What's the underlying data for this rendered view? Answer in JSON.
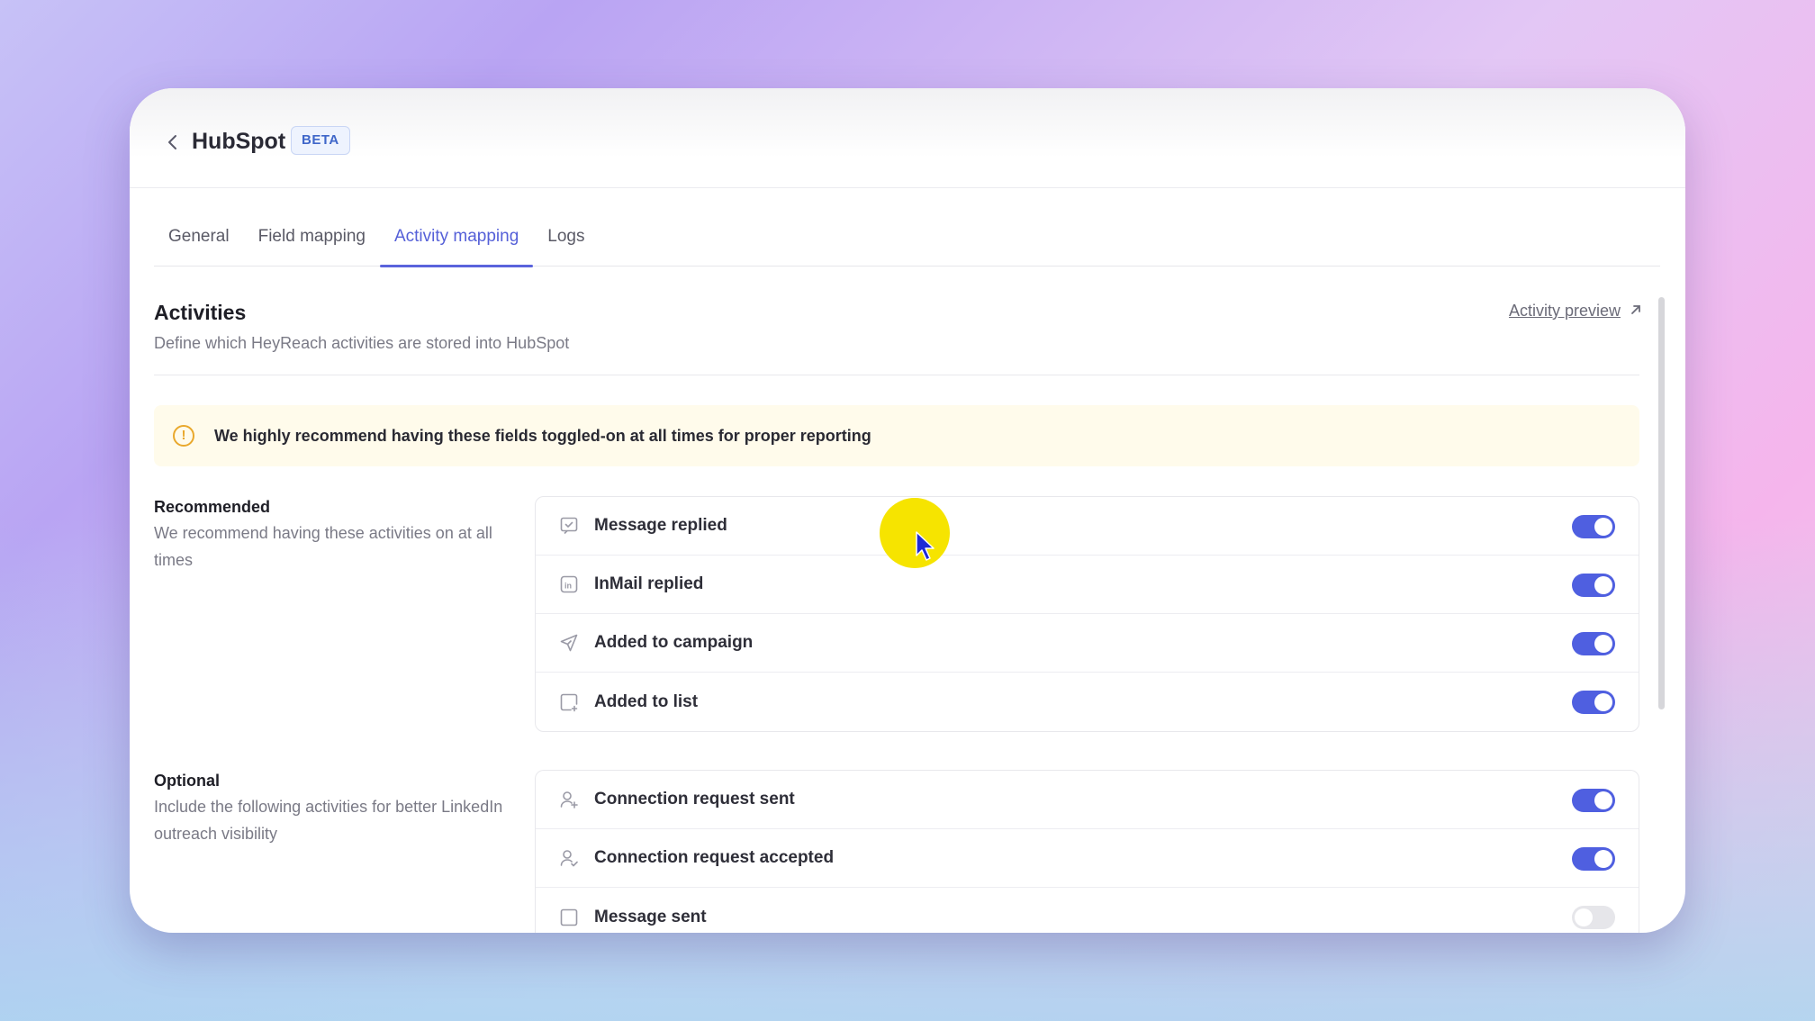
{
  "header": {
    "title": "HubSpot",
    "badge": "BETA"
  },
  "tabs": [
    {
      "label": "General"
    },
    {
      "label": "Field mapping"
    },
    {
      "label": "Activity mapping",
      "active": true
    },
    {
      "label": "Logs"
    }
  ],
  "activities": {
    "title": "Activities",
    "subtitle": "Define which HeyReach activities are stored into HubSpot",
    "preview_link": "Activity preview"
  },
  "alert": {
    "text": "We highly recommend having these fields toggled-on at all times for proper reporting"
  },
  "recommended": {
    "label": "Recommended",
    "description": "We recommend having these activities on at all times",
    "items": [
      {
        "label": "Message replied",
        "icon": "message-check-icon",
        "enabled": true
      },
      {
        "label": "InMail replied",
        "icon": "linkedin-icon",
        "enabled": true
      },
      {
        "label": "Added to campaign",
        "icon": "send-icon",
        "enabled": true
      },
      {
        "label": "Added to list",
        "icon": "list-add-icon",
        "enabled": true
      }
    ]
  },
  "optional": {
    "label": "Optional",
    "description": "Include the following activities for better LinkedIn outreach visibility",
    "items": [
      {
        "label": "Connection request sent",
        "icon": "user-plus-icon",
        "enabled": true
      },
      {
        "label": "Connection request accepted",
        "icon": "user-check-icon",
        "enabled": true
      },
      {
        "label": "Message sent",
        "icon": "message-icon",
        "enabled": false
      }
    ]
  },
  "colors": {
    "accent": "#4f5fe0",
    "alert_bg": "#fffbeb",
    "alert_icon": "#e9a82c",
    "cursor_halo": "#f6e400"
  }
}
